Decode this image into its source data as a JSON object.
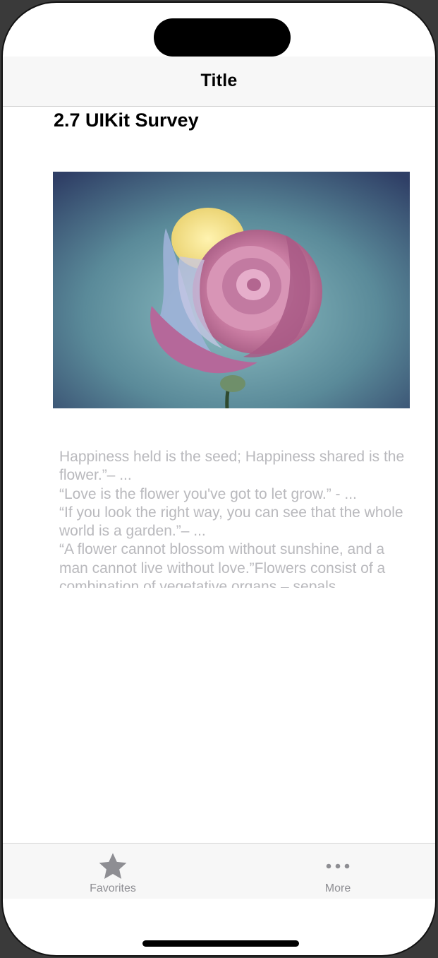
{
  "navigation": {
    "title": "Title"
  },
  "main": {
    "heading": "2.7 UIKit Survey",
    "image": {
      "subject": "rose-photo"
    },
    "body_text": "Happiness held is the seed; Happiness shared is the flower.”– ...\n“Love is the flower you've got to let grow.” - ...\n“If you look the right way, you can see that the whole world is a garden.”– ...\n“A flower cannot blossom without sunshine, and a man cannot live without love.”Flowers consist of a combination of vegetative organs – sepals"
  },
  "tab_bar": {
    "items": [
      {
        "label": "Favorites",
        "icon": "star-icon"
      },
      {
        "label": "More",
        "icon": "more-icon"
      }
    ]
  },
  "colors": {
    "tab_inactive": "#8e8e93",
    "body_text": "#b9b9bd",
    "bar_background": "#f7f7f7"
  }
}
